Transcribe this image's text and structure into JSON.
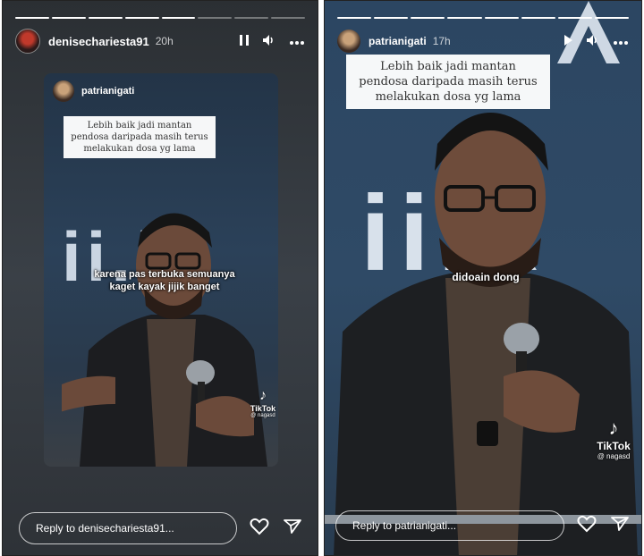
{
  "left_story": {
    "username": "denisechariesta91",
    "time": "20h",
    "progress": {
      "segments": 8,
      "done": 5
    },
    "shared_post": {
      "username": "patrianigati",
      "caption_lines": [
        "Lebih baik jadi mantan",
        "pendosa daripada masih terus",
        "melakukan dosa yg lama"
      ],
      "subtitle_lines": [
        "karena pas terbuka semuanya",
        "kaget kayak jijik banget"
      ],
      "tiktok_label": "TikTok",
      "tiktok_handle": "@ nagasd"
    },
    "reply_placeholder": "Reply to denisechariesta91..."
  },
  "right_story": {
    "username": "patrianigati",
    "time": "17h",
    "progress": {
      "segments": 8,
      "done": 8
    },
    "caption_lines": [
      "Lebih baik jadi mantan",
      "pendosa daripada masih terus",
      "melakukan dosa yg lama"
    ],
    "subtitle": "didoain dong",
    "tiktok_label": "TikTok",
    "tiktok_handle": "@ nagasd",
    "reply_placeholder": "Reply to patrianigati..."
  },
  "icons": {
    "pause": "pause-icon",
    "play": "play-icon",
    "volume": "volume-icon",
    "more": "more-icon",
    "heart": "heart-icon",
    "send": "send-icon"
  }
}
